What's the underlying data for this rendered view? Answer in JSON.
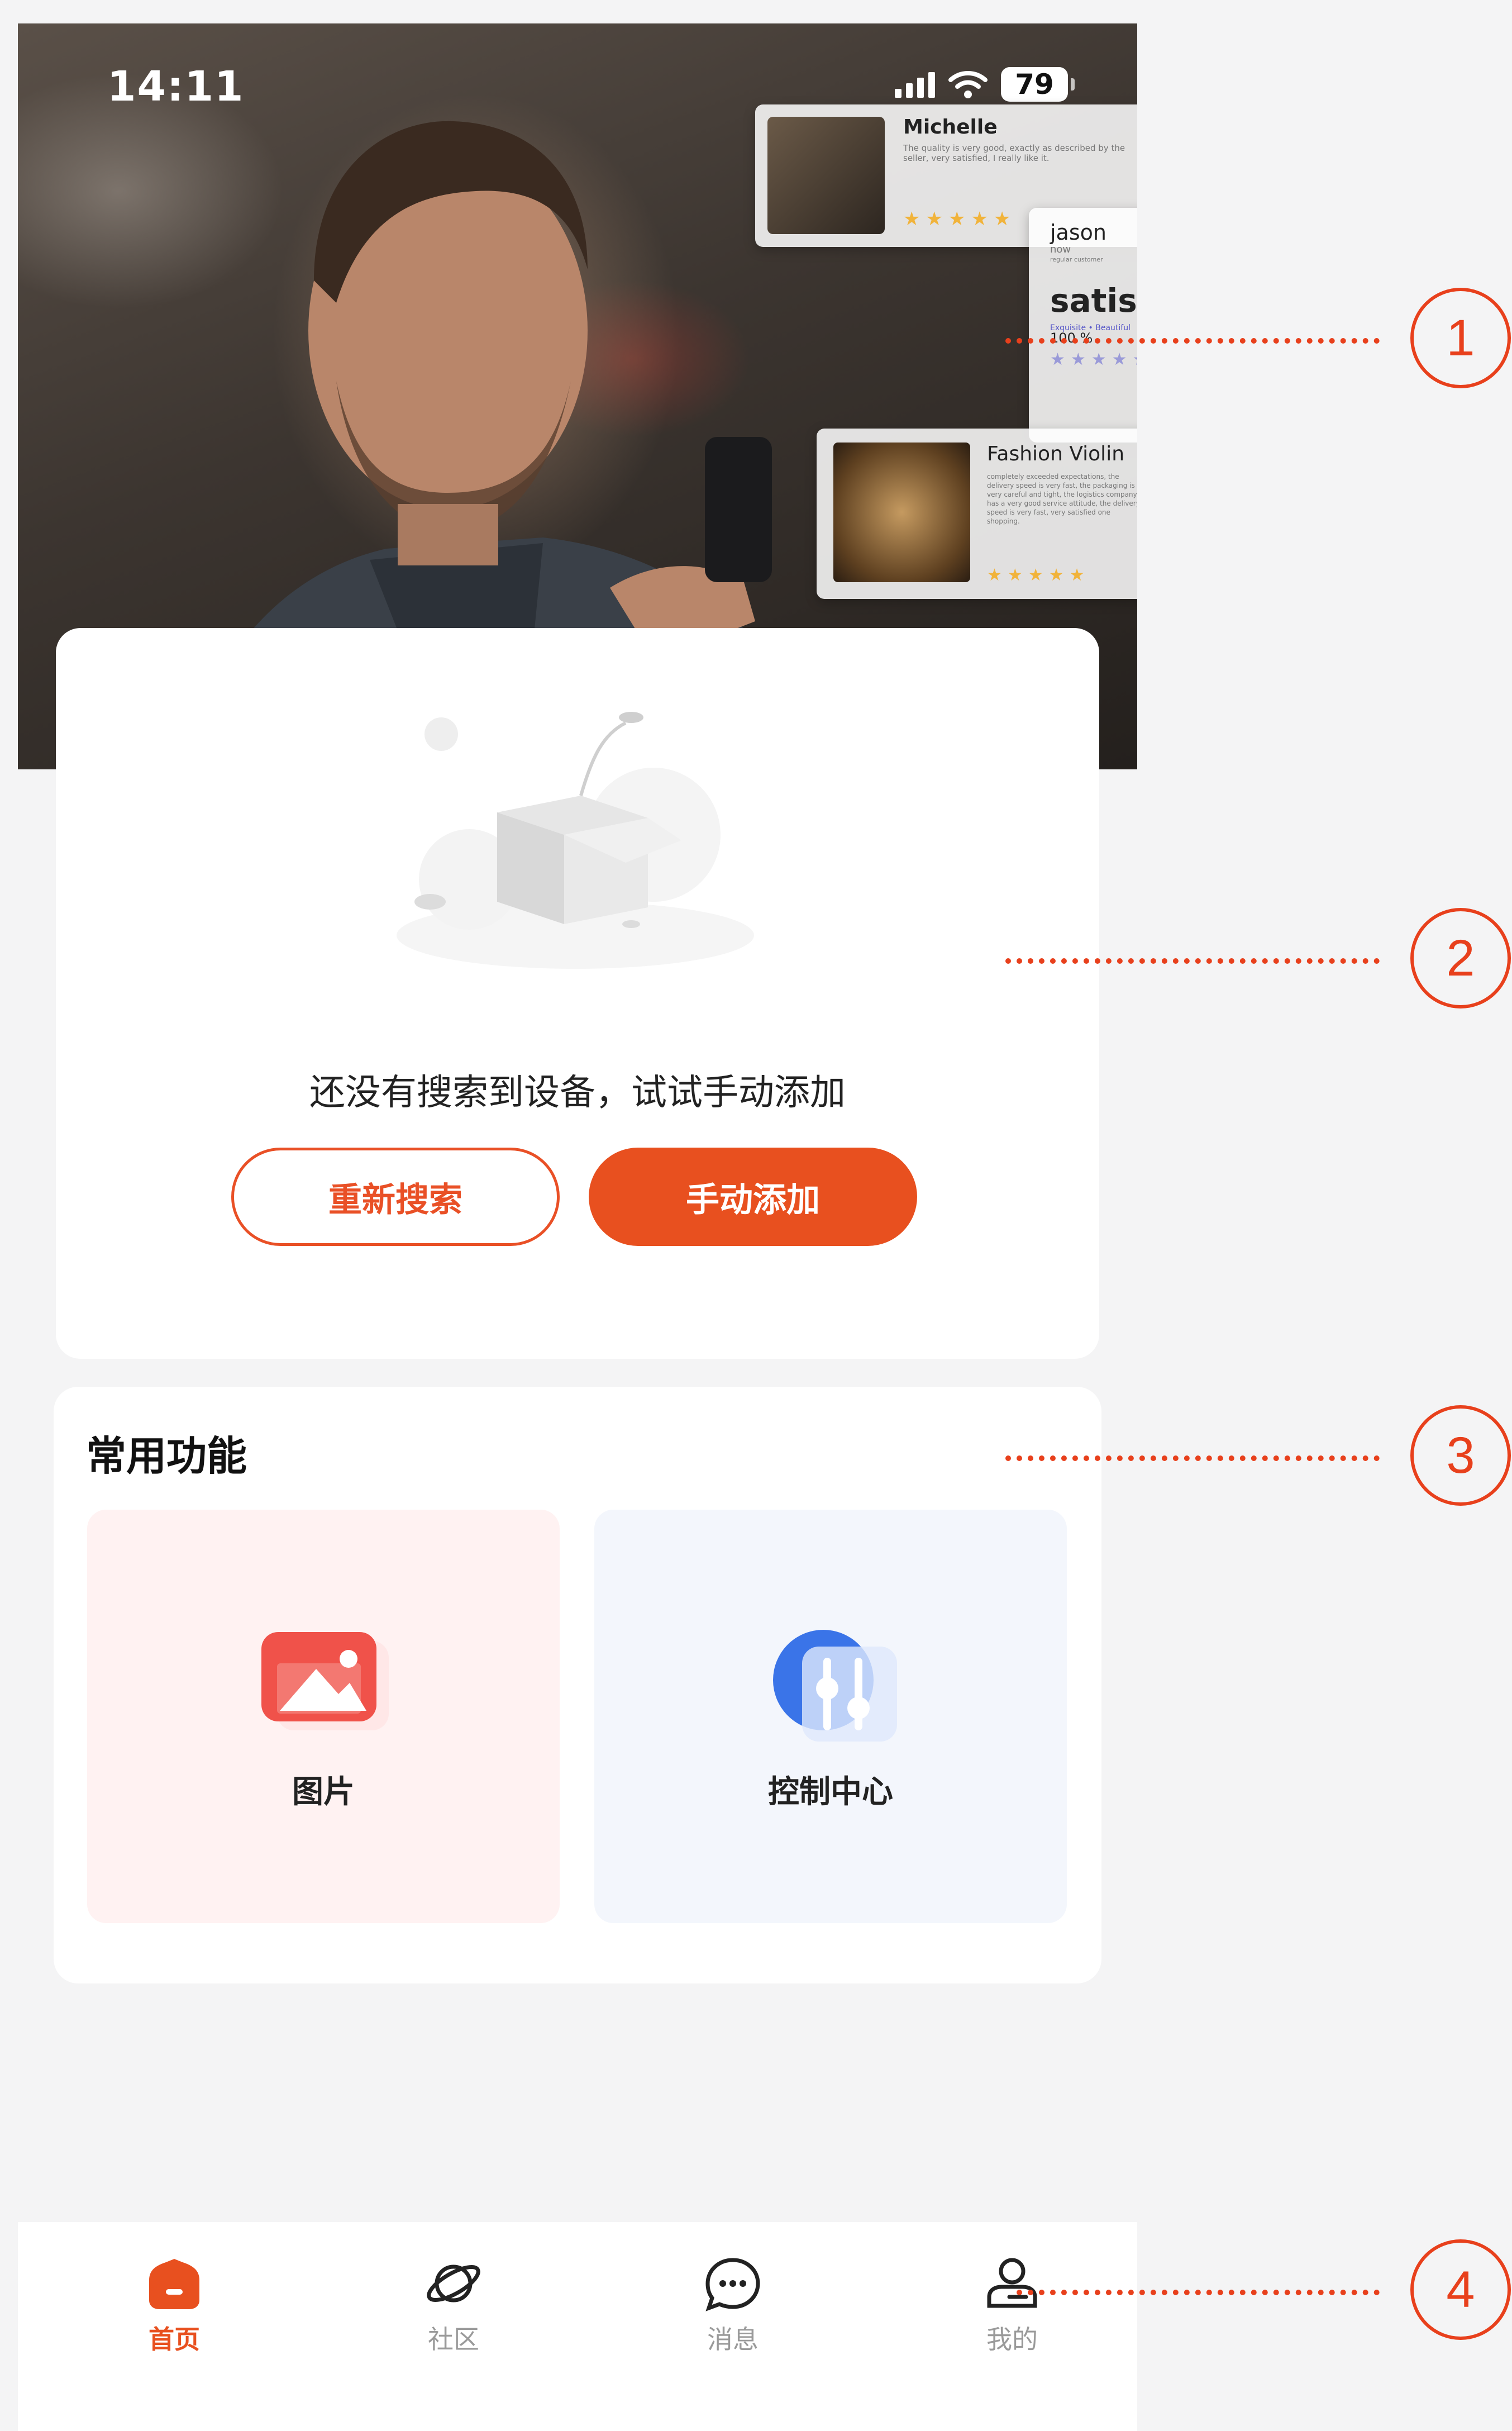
{
  "status_bar": {
    "time": "14:11",
    "battery": "79"
  },
  "hero": {
    "reviews": [
      {
        "name": "Michelle",
        "text": "The quality is very good, exactly as described by the seller, very satisfied, I really like it.",
        "stars": "★★★★★"
      },
      {
        "name": "jason",
        "meta": "now",
        "tag": "regular customer",
        "headline": "satisfy",
        "sub": "Exquisite • Beautiful",
        "percent": "100 %",
        "stars": "★★★★★"
      },
      {
        "name": "Fashion Violin",
        "text": "completely exceeded expectations, the delivery speed is very fast, the packaging is very careful and tight, the logistics company has a very good service attitude, the delivery speed is very fast, very satisfied one shopping.",
        "stars": "★★★★★"
      }
    ]
  },
  "empty_state": {
    "message": "还没有搜索到设备，试试手动添加",
    "research_button": "重新搜索",
    "manual_add_button": "手动添加"
  },
  "functions": {
    "title": "常用功能",
    "tiles": [
      {
        "label": "图片",
        "icon": "image-icon"
      },
      {
        "label": "控制中心",
        "icon": "control-center-icon"
      }
    ]
  },
  "tabbar": {
    "tabs": [
      {
        "label": "首页",
        "icon": "home-icon",
        "active": true
      },
      {
        "label": "社区",
        "icon": "planet-icon",
        "active": false
      },
      {
        "label": "消息",
        "icon": "message-icon",
        "active": false
      },
      {
        "label": "我的",
        "icon": "profile-icon",
        "active": false
      }
    ]
  },
  "callouts": [
    "1",
    "2",
    "3",
    "4"
  ],
  "colors": {
    "accent": "#e8501f",
    "callout": "#e8401c",
    "background": "#f4f4f5"
  }
}
